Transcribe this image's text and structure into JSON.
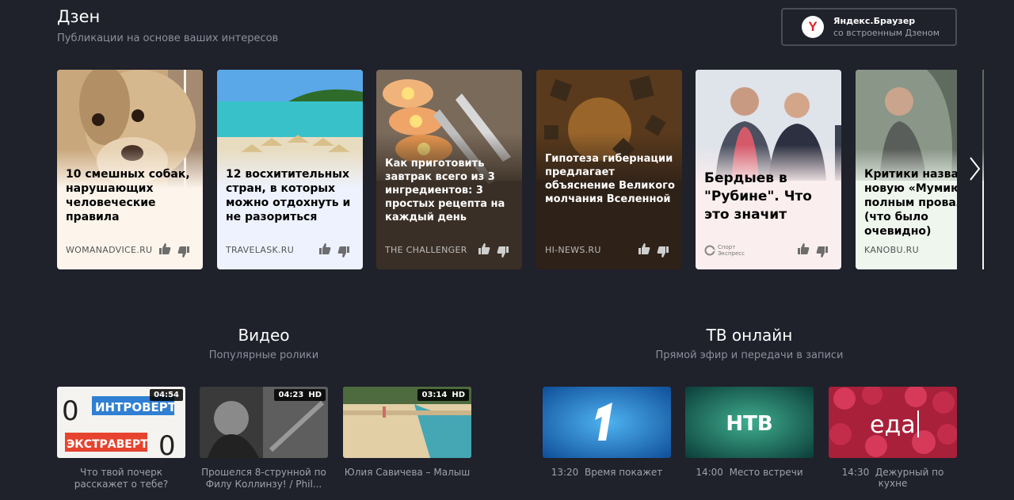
{
  "zen": {
    "title": "Дзен",
    "subtitle": "Публикации на основе ваших интересов",
    "browser_promo": {
      "name": "Яндекс.Браузер",
      "tagline": "со встроенным Дзеном",
      "logo_letter": "Y"
    },
    "cards": [
      {
        "title": "10 смешных собак, нарушающих человеческие правила",
        "source": "WOMANADVICE.RU",
        "theme": "light"
      },
      {
        "title": "12 восхитительных стран, в которых можно отдохнуть и не разориться",
        "source": "TRAVELASK.RU",
        "theme": "light"
      },
      {
        "title": "Как приготовить завтрак всего из 3 ингредиентов: 3 простых рецепта на каждый день",
        "source": "THE CHALLENGER",
        "theme": "dark"
      },
      {
        "title": "Гипотеза гибернации предлагает объяснение Великого молчания Вселенной",
        "source": "HI-NEWS.RU",
        "theme": "dark"
      },
      {
        "title": "Бердыев в \"Рубине\". Что это значит",
        "source_logo_line1": "Спорт",
        "source_logo_line2": "Экспресс",
        "theme": "light"
      },
      {
        "title": "Критики назвали новую «Мумию» полным провалом (что было очевидно)",
        "source": "KANOBU.RU",
        "theme": "light"
      }
    ]
  },
  "video": {
    "title": "Видео",
    "subtitle": "Популярные ролики",
    "items": [
      {
        "duration": "04:54",
        "hd": false,
        "caption": "Что твой почерк расскажет о тебе?",
        "thumb_text_1": "ИНТРОВЕРТ",
        "thumb_text_2": "ЭКСТРАВЕРТ"
      },
      {
        "duration": "04:23",
        "hd": true,
        "hd_label": "HD",
        "caption": "Прошелся 8-струнной по Филу Коллинзу! / Phil..."
      },
      {
        "duration": "03:14",
        "hd": true,
        "hd_label": "HD",
        "caption": "Юлия Савичева – Малыш"
      }
    ]
  },
  "tv": {
    "title": "ТВ онлайн",
    "subtitle": "Прямой эфир и передачи в записи",
    "channels": [
      {
        "logo": "1",
        "time": "13:20",
        "show": "Время покажет"
      },
      {
        "logo": "НТВ",
        "time": "14:00",
        "show": "Место встречи"
      },
      {
        "logo": "еда",
        "time": "14:30",
        "show": "Дежурный по кухне"
      }
    ]
  },
  "colors": {
    "background": "#1f212b",
    "muted_text": "#8c8f9c",
    "yandex_red": "#e31e24"
  }
}
